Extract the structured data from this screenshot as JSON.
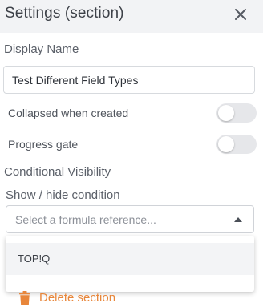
{
  "header": {
    "title": "Settings (section)",
    "close_icon": "close-icon"
  },
  "display_name": {
    "label": "Display Name",
    "value": "Test Different Field Types"
  },
  "options": [
    {
      "label": "Collapsed when created",
      "enabled": false
    },
    {
      "label": "Progress gate",
      "enabled": false
    }
  ],
  "conditional_visibility": {
    "heading": "Conditional Visibility",
    "condition_label": "Show / hide condition",
    "select_placeholder": "Select a formula reference...",
    "dropdown_open": true,
    "dropdown_options": [
      "TOP!Q"
    ]
  },
  "delete": {
    "label": "Delete section",
    "icon": "trash-icon"
  },
  "colors": {
    "accent_orange": "#e8863a",
    "header_bg": "#f2f3f5",
    "toggle_off": "#e6e7ea"
  }
}
